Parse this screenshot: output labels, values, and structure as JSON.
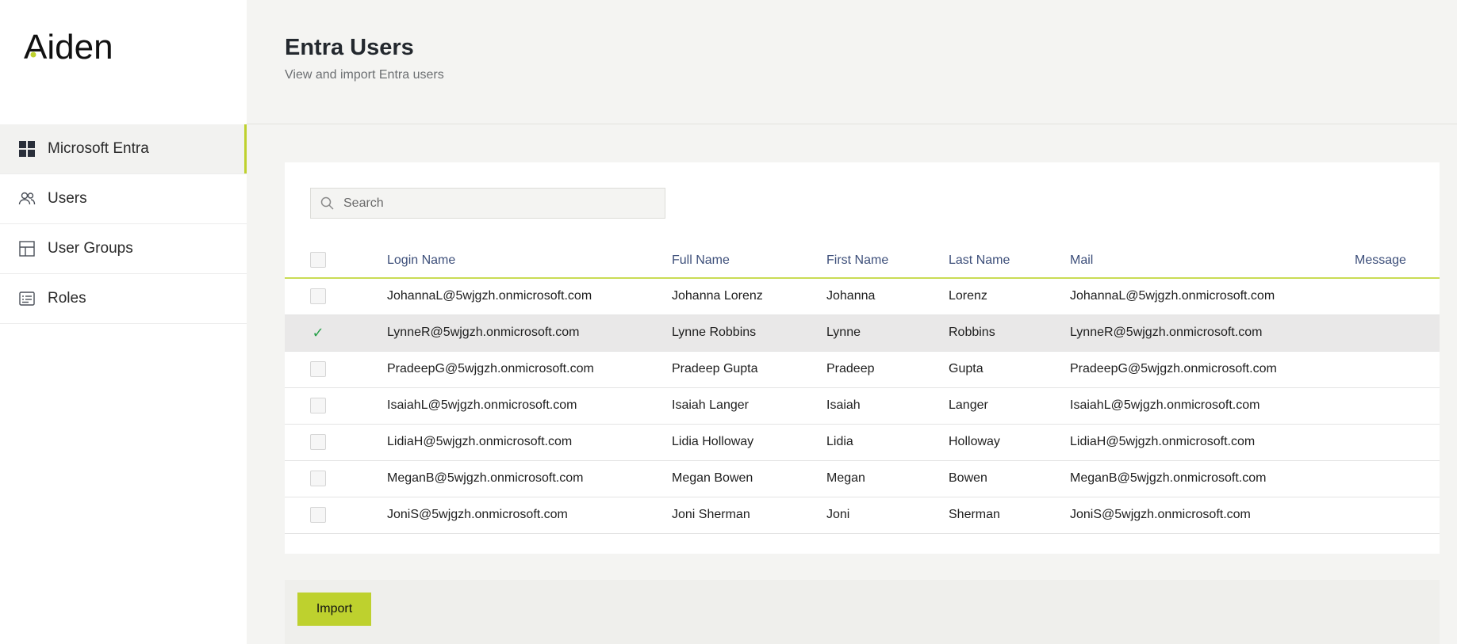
{
  "app": {
    "logo_text": "Aiden",
    "accent_color": "#bed12e"
  },
  "sidebar": {
    "items": [
      {
        "label": "Microsoft Entra",
        "icon": "grid-icon",
        "active": true
      },
      {
        "label": "Users",
        "icon": "users-icon",
        "active": false
      },
      {
        "label": "User Groups",
        "icon": "layout-icon",
        "active": false
      },
      {
        "label": "Roles",
        "icon": "id-card-icon",
        "active": false
      }
    ]
  },
  "header": {
    "title": "Entra Users",
    "subtitle": "View and import Entra users"
  },
  "search": {
    "placeholder": "Search",
    "value": ""
  },
  "table": {
    "columns": [
      "Login Name",
      "Full Name",
      "First Name",
      "Last Name",
      "Mail",
      "Message"
    ],
    "rows": [
      {
        "login": "JohannaL@5wjgzh.onmicrosoft.com",
        "full": "Johanna Lorenz",
        "first": "Johanna",
        "last": "Lorenz",
        "mail": "JohannaL@5wjgzh.onmicrosoft.com",
        "message": "",
        "selected": false
      },
      {
        "login": "LynneR@5wjgzh.onmicrosoft.com",
        "full": "Lynne Robbins",
        "first": "Lynne",
        "last": "Robbins",
        "mail": "LynneR@5wjgzh.onmicrosoft.com",
        "message": "",
        "selected": true
      },
      {
        "login": "PradeepG@5wjgzh.onmicrosoft.com",
        "full": "Pradeep Gupta",
        "first": "Pradeep",
        "last": "Gupta",
        "mail": "PradeepG@5wjgzh.onmicrosoft.com",
        "message": "",
        "selected": false
      },
      {
        "login": "IsaiahL@5wjgzh.onmicrosoft.com",
        "full": "Isaiah Langer",
        "first": "Isaiah",
        "last": "Langer",
        "mail": "IsaiahL@5wjgzh.onmicrosoft.com",
        "message": "",
        "selected": false
      },
      {
        "login": "LidiaH@5wjgzh.onmicrosoft.com",
        "full": "Lidia Holloway",
        "first": "Lidia",
        "last": "Holloway",
        "mail": "LidiaH@5wjgzh.onmicrosoft.com",
        "message": "",
        "selected": false
      },
      {
        "login": "MeganB@5wjgzh.onmicrosoft.com",
        "full": "Megan Bowen",
        "first": "Megan",
        "last": "Bowen",
        "mail": "MeganB@5wjgzh.onmicrosoft.com",
        "message": "",
        "selected": false
      },
      {
        "login": "JoniS@5wjgzh.onmicrosoft.com",
        "full": "Joni Sherman",
        "first": "Joni",
        "last": "Sherman",
        "mail": "JoniS@5wjgzh.onmicrosoft.com",
        "message": "",
        "selected": false
      }
    ]
  },
  "footer": {
    "import_label": "Import"
  }
}
